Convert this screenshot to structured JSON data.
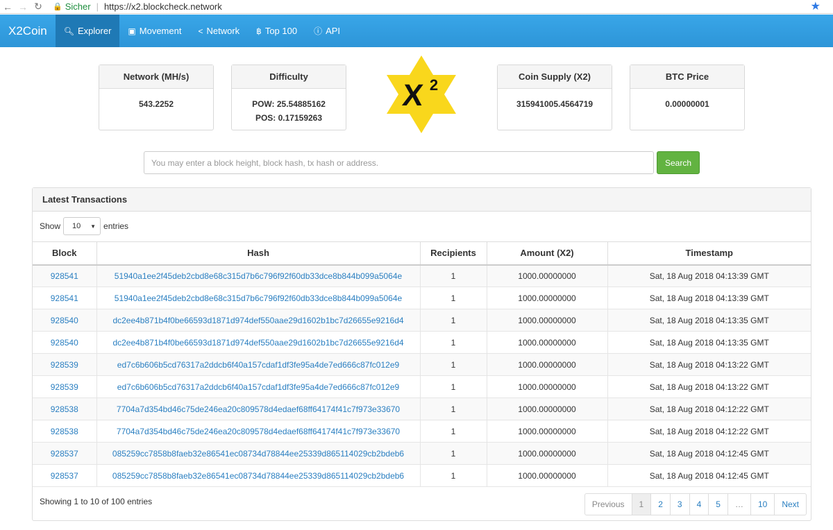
{
  "browser": {
    "secure_label": "Sicher",
    "url": "https://x2.blockcheck.network"
  },
  "navbar": {
    "brand": "X2Coin",
    "items": [
      {
        "label": "Explorer",
        "icon": "search-icon",
        "active": true
      },
      {
        "label": "Movement",
        "icon": "money-icon"
      },
      {
        "label": "Network",
        "icon": "share-icon"
      },
      {
        "label": "Top 100",
        "icon": "bitcoin-icon"
      },
      {
        "label": "API",
        "icon": "info-icon"
      }
    ]
  },
  "stats": {
    "network": {
      "title": "Network (MH/s)",
      "value": "543.2252"
    },
    "difficulty": {
      "title": "Difficulty",
      "pow": "POW: 25.54885162",
      "pos": "POS: 0.17159263"
    },
    "supply": {
      "title": "Coin Supply (X2)",
      "value": "315941005.4564719"
    },
    "btc": {
      "title": "BTC Price",
      "value": "0.00000001"
    }
  },
  "logo": {
    "text": "X",
    "sup": "2",
    "color": "#f9d71c"
  },
  "search": {
    "placeholder": "You may enter a block height, block hash, tx hash or address.",
    "button": "Search"
  },
  "latest": {
    "title": "Latest Transactions",
    "show_label": "Show",
    "entries_label": "entries",
    "page_length": "10",
    "columns": [
      "Block",
      "Hash",
      "Recipients",
      "Amount (X2)",
      "Timestamp"
    ],
    "rows": [
      [
        "928541",
        "51940a1ee2f45deb2cbd8e68c315d7b6c796f92f60db33dce8b844b099a5064e",
        "1",
        "1000.00000000",
        "Sat, 18 Aug 2018 04:13:39 GMT"
      ],
      [
        "928541",
        "51940a1ee2f45deb2cbd8e68c315d7b6c796f92f60db33dce8b844b099a5064e",
        "1",
        "1000.00000000",
        "Sat, 18 Aug 2018 04:13:39 GMT"
      ],
      [
        "928540",
        "dc2ee4b871b4f0be66593d1871d974def550aae29d1602b1bc7d26655e9216d4",
        "1",
        "1000.00000000",
        "Sat, 18 Aug 2018 04:13:35 GMT"
      ],
      [
        "928540",
        "dc2ee4b871b4f0be66593d1871d974def550aae29d1602b1bc7d26655e9216d4",
        "1",
        "1000.00000000",
        "Sat, 18 Aug 2018 04:13:35 GMT"
      ],
      [
        "928539",
        "ed7c6b606b5cd76317a2ddcb6f40a157cdaf1df3fe95a4de7ed666c87fc012e9",
        "1",
        "1000.00000000",
        "Sat, 18 Aug 2018 04:13:22 GMT"
      ],
      [
        "928539",
        "ed7c6b606b5cd76317a2ddcb6f40a157cdaf1df3fe95a4de7ed666c87fc012e9",
        "1",
        "1000.00000000",
        "Sat, 18 Aug 2018 04:13:22 GMT"
      ],
      [
        "928538",
        "7704a7d354bd46c75de246ea20c809578d4edaef68ff64174f41c7f973e33670",
        "1",
        "1000.00000000",
        "Sat, 18 Aug 2018 04:12:22 GMT"
      ],
      [
        "928538",
        "7704a7d354bd46c75de246ea20c809578d4edaef68ff64174f41c7f973e33670",
        "1",
        "1000.00000000",
        "Sat, 18 Aug 2018 04:12:22 GMT"
      ],
      [
        "928537",
        "085259cc7858b8faeb32e86541ec08734d78844ee25339d865114029cb2bdeb6",
        "1",
        "1000.00000000",
        "Sat, 18 Aug 2018 04:12:45 GMT"
      ],
      [
        "928537",
        "085259cc7858b8faeb32e86541ec08734d78844ee25339d865114029cb2bdeb6",
        "1",
        "1000.00000000",
        "Sat, 18 Aug 2018 04:12:45 GMT"
      ]
    ],
    "info": "Showing 1 to 10 of 100 entries",
    "pagination": {
      "previous": "Previous",
      "pages": [
        "1",
        "2",
        "3",
        "4",
        "5",
        "…",
        "10"
      ],
      "current": "1",
      "next": "Next"
    }
  }
}
